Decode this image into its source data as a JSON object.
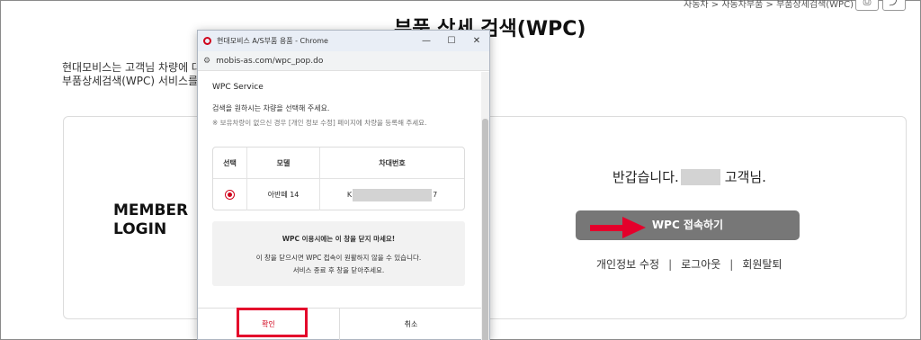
{
  "page": {
    "title": "부품 상세 검색(WPC)",
    "breadcrumb": "자동차 > 자동차부품 > 부품상세검색(WPC)",
    "intro_line1": "현대모비스는 고객님 차량에 대한",
    "intro_line2": "부품상세검색(WPC) 서비스를 제"
  },
  "member": {
    "login_title": "MEMBER\nLOGIN"
  },
  "greeting": {
    "prefix": "반갑습니다.",
    "suffix": "고객님."
  },
  "main_button": {
    "label": "WPC 접속하기"
  },
  "links": [
    "개인정보 수정",
    "로그아웃",
    "회원탈퇴"
  ],
  "popup": {
    "window_title": "현대모비스 A/S부품 용품 - Chrome",
    "url": "mobis-as.com/wpc_pop.do",
    "service_label": "WPC Service",
    "instruction": "검색을 원하시는 차량을 선택해 주세요.",
    "sub_instruction": "※ 보유차량이 없으신 경우 [개인 정보 수정] 페이지에 차량을 등록해 주세요.",
    "table": {
      "headers": [
        "선택",
        "모델",
        "차대번호"
      ],
      "rows": [
        {
          "model": "아반떼 14",
          "vin_start": "K",
          "vin_end": "7"
        }
      ]
    },
    "notice": {
      "title": "WPC 이용시에는 이 창을 닫지 마세요!",
      "line1": "이 창을 닫으시면 WPC 접속이 원활하지 않을 수 있습니다.",
      "line2": "서비스 종료 후 창을 닫아주세요."
    },
    "confirm_label": "확인",
    "cancel_label": "취소"
  },
  "colors": {
    "accent_red": "#d0021b",
    "highlight_red": "#e4002b",
    "main_button_bg": "#777777"
  }
}
